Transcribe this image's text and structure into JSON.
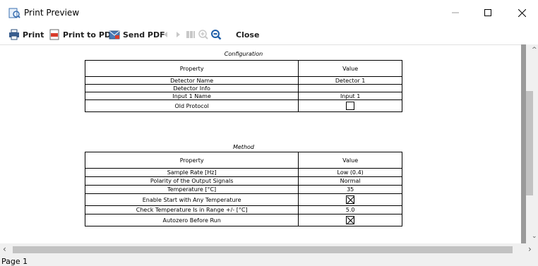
{
  "window": {
    "title": "Print Preview"
  },
  "toolbar": {
    "print_label": "Print",
    "print_pdf_label": "Print to PDF",
    "send_pdf_label": "Send PDF",
    "close_label": "Close"
  },
  "configuration": {
    "title": "Configuration",
    "header_property": "Property",
    "header_value": "Value",
    "rows": [
      {
        "property": "Detector Name",
        "value": "Detector 1"
      },
      {
        "property": "Detector Info",
        "value": ""
      },
      {
        "property": "Input 1 Name",
        "value": "Input 1"
      },
      {
        "property": "Old Protocol",
        "value": "",
        "checkbox": "unchecked"
      }
    ]
  },
  "method": {
    "title": "Method",
    "header_property": "Property",
    "header_value": "Value",
    "rows": [
      {
        "property": "Sample Rate [Hz]",
        "value": "Low (0.4)"
      },
      {
        "property": "Polarity of the Output Signals",
        "value": "Normal"
      },
      {
        "property": "Temperature [°C]",
        "value": "35"
      },
      {
        "property": "Enable Start with Any Temperature",
        "value": "",
        "checkbox": "checked"
      },
      {
        "property": "Check Temperature Is in Range +/- [°C]",
        "value": "5.0"
      },
      {
        "property": "Autozero Before Run",
        "value": "",
        "checkbox": "checked"
      }
    ]
  },
  "status": {
    "page_label": "Page 1"
  }
}
